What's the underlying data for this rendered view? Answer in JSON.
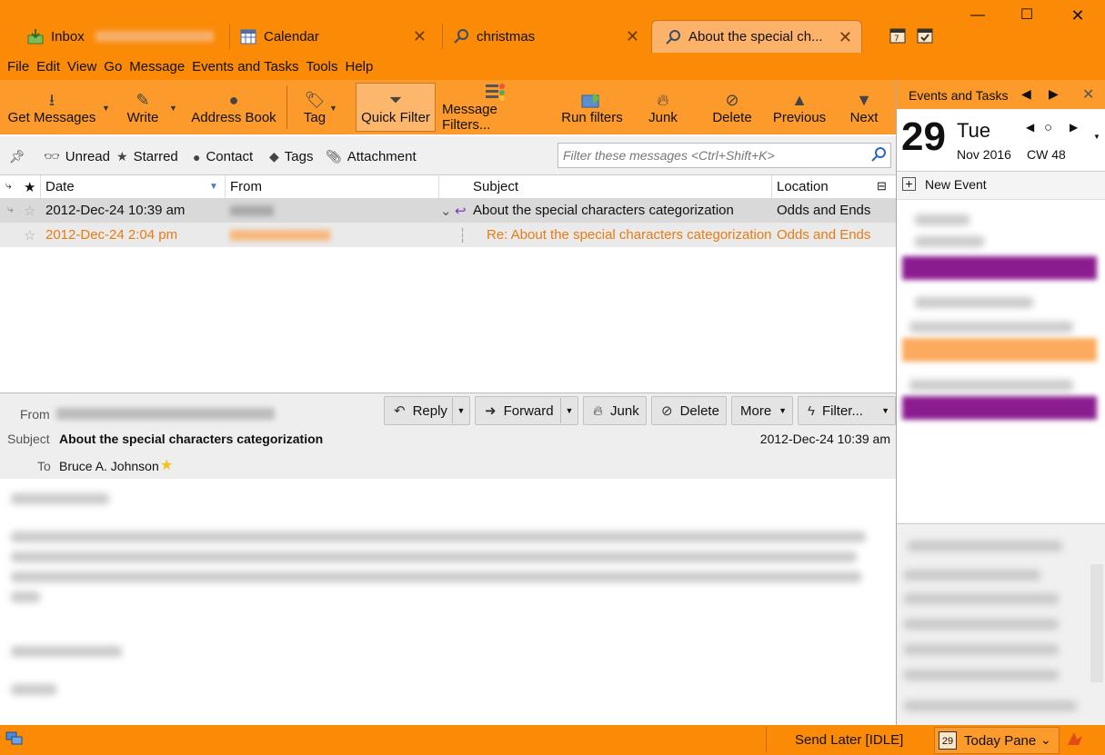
{
  "tabs": [
    {
      "label": "Inbox",
      "icon": "inbox-icon"
    },
    {
      "label": "Calendar",
      "icon": "calendar-icon"
    },
    {
      "label": "christmas",
      "icon": "search-icon"
    },
    {
      "label": "About the special ch...",
      "icon": "search-icon"
    }
  ],
  "menu": [
    "File",
    "Edit",
    "View",
    "Go",
    "Message",
    "Events and Tasks",
    "Tools",
    "Help"
  ],
  "toolbar": {
    "get_messages": "Get Messages",
    "write": "Write",
    "address_book": "Address Book",
    "tag": "Tag",
    "quick_filter": "Quick Filter",
    "message_filters": "Message Filters...",
    "run_filters": "Run filters",
    "junk": "Junk",
    "delete": "Delete",
    "previous": "Previous",
    "next": "Next"
  },
  "quick_filter_bar": {
    "unread": "Unread",
    "starred": "Starred",
    "contact": "Contact",
    "tags": "Tags",
    "attachment": "Attachment",
    "placeholder": "Filter these messages <Ctrl+Shift+K>"
  },
  "columns": {
    "date": "Date",
    "from": "From",
    "subject": "Subject",
    "location": "Location"
  },
  "messages": [
    {
      "date": "2012-Dec-24 10:39 am",
      "subject": "About the special characters categorization",
      "location": "Odds and Ends"
    },
    {
      "date": "2012-Dec-24 2:04 pm",
      "subject": "Re: About the special characters categorization",
      "location": "Odds and Ends"
    }
  ],
  "message_header": {
    "from_label": "From",
    "subject_label": "Subject",
    "subject": "About the special characters categorization",
    "date": "2012-Dec-24 10:39 am",
    "to_label": "To",
    "to": "Bruce A. Johnson",
    "buttons": {
      "reply": "Reply",
      "forward": "Forward",
      "junk": "Junk",
      "delete": "Delete",
      "more": "More",
      "filter": "Filter..."
    }
  },
  "today_pane": {
    "title": "Events and Tasks",
    "day": "29",
    "weekday": "Tue",
    "month_year": "Nov 2016",
    "week": "CW 48",
    "new_event": "New Event"
  },
  "statusbar": {
    "send_later": "Send Later [IDLE]",
    "today_pane": "Today Pane",
    "today_day": "29"
  },
  "colors": {
    "accent": "#fb8a07",
    "toolbar": "#fc9a2c",
    "reply_text": "#e87b11",
    "event_purple": "#8b1c8f",
    "event_orange": "#fbaa5e"
  }
}
